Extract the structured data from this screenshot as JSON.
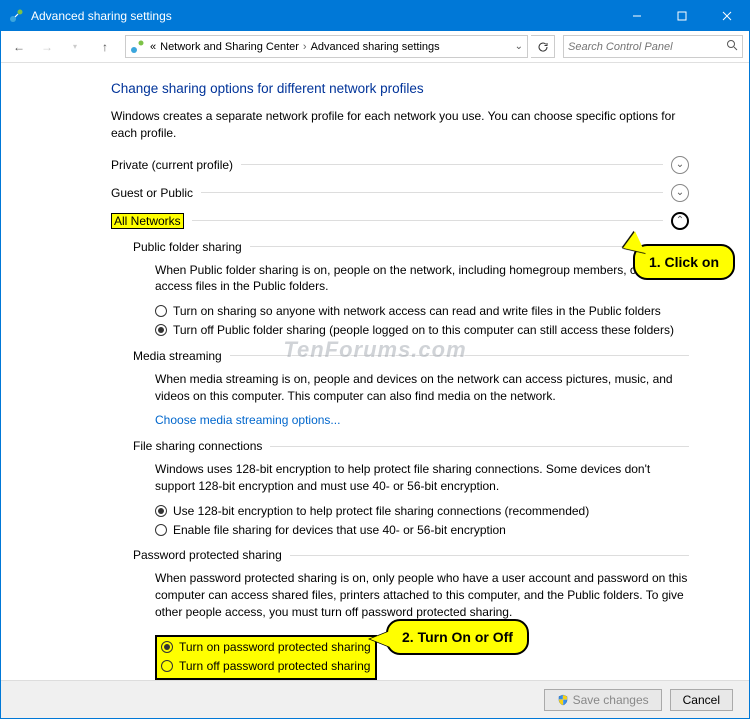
{
  "titlebar": {
    "icon": "network-icon",
    "title": "Advanced sharing settings"
  },
  "breadcrumb": {
    "items": [
      "Network and Sharing Center",
      "Advanced sharing settings"
    ],
    "prefix": "«"
  },
  "search": {
    "placeholder": "Search Control Panel"
  },
  "header": {
    "title": "Change sharing options for different network profiles",
    "description": "Windows creates a separate network profile for each network you use. You can choose specific options for each profile."
  },
  "sections": {
    "private": {
      "title": "Private (current profile)"
    },
    "guest": {
      "title": "Guest or Public"
    },
    "allnet": {
      "title": "All Networks"
    }
  },
  "publicFolderSharing": {
    "title": "Public folder sharing",
    "desc": "When Public folder sharing is on, people on the network, including homegroup members, can access files in the Public folders.",
    "opt1": "Turn on sharing so anyone with network access can read and write files in the Public folders",
    "opt2": "Turn off Public folder sharing (people logged on to this computer can still access these folders)"
  },
  "mediaStreaming": {
    "title": "Media streaming",
    "desc": "When media streaming is on, people and devices on the network can access pictures, music, and videos on this computer. This computer can also find media on the network.",
    "link": "Choose media streaming options..."
  },
  "fileSharing": {
    "title": "File sharing connections",
    "desc": "Windows uses 128-bit encryption to help protect file sharing connections. Some devices don't support 128-bit encryption and must use 40- or 56-bit encryption.",
    "opt1": "Use 128-bit encryption to help protect file sharing connections (recommended)",
    "opt2": "Enable file sharing for devices that use 40- or 56-bit encryption"
  },
  "passwordSharing": {
    "title": "Password protected sharing",
    "desc": "When password protected sharing is on, only people who have a user account and password on this computer can access shared files, printers attached to this computer, and the Public folders. To give other people access, you must turn off password protected sharing.",
    "opt1": "Turn on password protected sharing",
    "opt2": "Turn off password protected sharing"
  },
  "callouts": {
    "c1": "1. Click on",
    "c2": "2. Turn On or Off"
  },
  "watermark": "TenForums.com",
  "buttons": {
    "save": "Save changes",
    "cancel": "Cancel"
  }
}
